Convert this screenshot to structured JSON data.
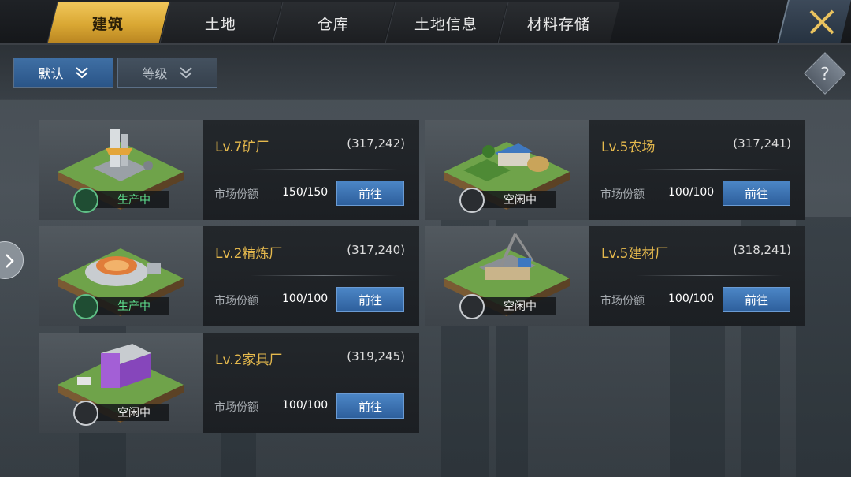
{
  "tabs": [
    {
      "label": "建筑",
      "active": true
    },
    {
      "label": "土地",
      "active": false
    },
    {
      "label": "仓库",
      "active": false
    },
    {
      "label": "土地信息",
      "active": false
    },
    {
      "label": "材料存储",
      "active": false
    }
  ],
  "filters": {
    "default_label": "默认",
    "level_label": "等级"
  },
  "help": {
    "label": "?"
  },
  "colors": {
    "accent_gold": "#e5b94d",
    "button_blue": "#3f74b4",
    "busy_green": "#5fe08f"
  },
  "buildings": [
    {
      "title": "Lv.7矿厂",
      "coord": "(317,242)",
      "share_label": "市场份额",
      "share_value": "150/150",
      "button": "前往",
      "status": "生产中",
      "status_type": "busy",
      "icon": "mine-building-icon"
    },
    {
      "title": "Lv.5农场",
      "coord": "(317,241)",
      "share_label": "市场份额",
      "share_value": "100/100",
      "button": "前往",
      "status": "空闲中",
      "status_type": "idle",
      "icon": "farm-building-icon"
    },
    {
      "title": "Lv.2精炼厂",
      "coord": "(317,240)",
      "share_label": "市场份额",
      "share_value": "100/100",
      "button": "前往",
      "status": "生产中",
      "status_type": "busy",
      "icon": "refinery-building-icon"
    },
    {
      "title": "Lv.5建材厂",
      "coord": "(318,241)",
      "share_label": "市场份额",
      "share_value": "100/100",
      "button": "前往",
      "status": "空闲中",
      "status_type": "idle",
      "icon": "building-materials-factory-icon"
    },
    {
      "title": "Lv.2家具厂",
      "coord": "(319,245)",
      "share_label": "市场份额",
      "share_value": "100/100",
      "button": "前往",
      "status": "空闲中",
      "status_type": "idle",
      "icon": "furniture-factory-icon"
    }
  ]
}
